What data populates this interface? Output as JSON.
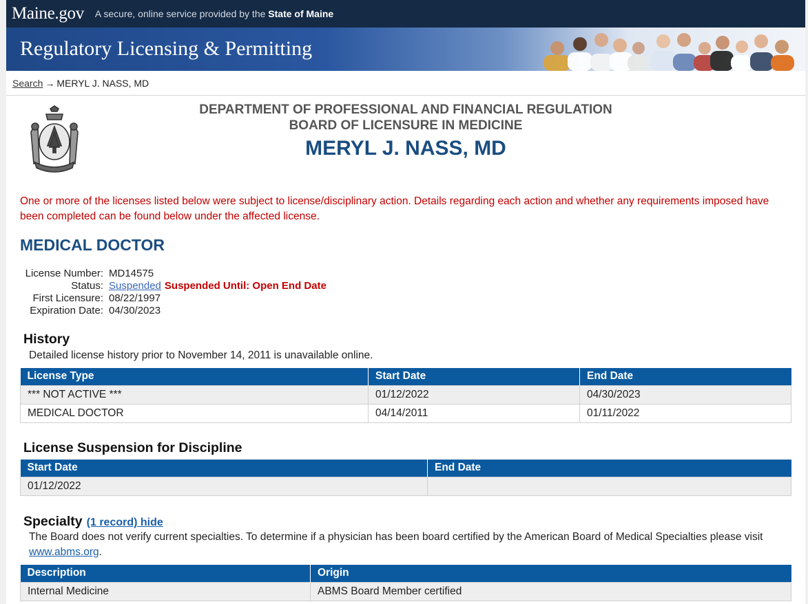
{
  "header": {
    "logo": "Maine.gov",
    "tagline_prefix": "A secure, online service provided by the",
    "tagline_state": "State of Maine",
    "banner_title": "Regulatory Licensing & Permitting"
  },
  "breadcrumb": {
    "search_link": "Search",
    "arrow": "→",
    "current": "MERYL J. NASS, MD"
  },
  "agency": {
    "department": "DEPARTMENT OF PROFESSIONAL AND FINANCIAL REGULATION",
    "board": "BOARD OF LICENSURE IN MEDICINE",
    "person": "MERYL J. NASS, MD"
  },
  "notice": "One or more of the licenses listed below were subject to license/disciplinary action. Details regarding each action and whether any requirements imposed have been completed can be found below under the affected license.",
  "license": {
    "section_title": "MEDICAL DOCTOR",
    "number_label": "License Number:",
    "number": "MD14575",
    "status_label": "Status:",
    "status_link": "Suspended",
    "status_note": "Suspended Until: Open End Date",
    "first_label": "First Licensure:",
    "first": "08/22/1997",
    "exp_label": "Expiration Date:",
    "exp": "04/30/2023"
  },
  "history": {
    "title": "History",
    "note": "Detailed license history prior to November 14, 2011 is unavailable online.",
    "columns": [
      "License Type",
      "Start Date",
      "End Date"
    ],
    "rows": [
      [
        "*** NOT ACTIVE ***",
        "01/12/2022",
        "04/30/2023"
      ],
      [
        "MEDICAL DOCTOR",
        "04/14/2011",
        "01/11/2022"
      ]
    ]
  },
  "suspension": {
    "title": "License Suspension for Discipline",
    "columns": [
      "Start Date",
      "End Date"
    ],
    "rows": [
      [
        "01/12/2022",
        ""
      ]
    ]
  },
  "specialty": {
    "title": "Specialty",
    "toggle": "(1 record) hide",
    "note_prefix": "The Board does not verify current specialties. To determine if a physician has been board certified by the American Board of Medical Specialties please visit",
    "note_link": "www.abms.org",
    "note_suffix": ".",
    "columns": [
      "Description",
      "Origin"
    ],
    "rows": [
      [
        "Internal Medicine",
        "ABMS Board Member certified"
      ]
    ]
  }
}
